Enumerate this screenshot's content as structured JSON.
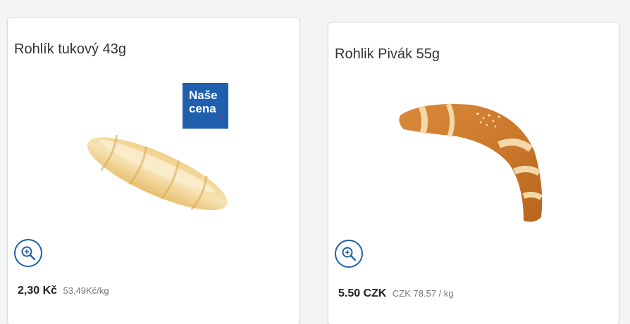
{
  "products": [
    {
      "title": "Rohlík tukový 43g",
      "badge": {
        "line1": "Naše",
        "line2": "cena"
      },
      "price": "2,30 Kč",
      "unit_price": "53,49Kč/kg"
    },
    {
      "title": "Rohlik Pivák 55g",
      "price": "5.50 CZK",
      "unit_price": "CZK 78.57 / kg"
    }
  ],
  "colors": {
    "accent": "#1f5fae",
    "badge_dot": "#e2232a",
    "background": "#f3f4f6"
  },
  "icons": {
    "zoom": "zoom-in-icon"
  }
}
